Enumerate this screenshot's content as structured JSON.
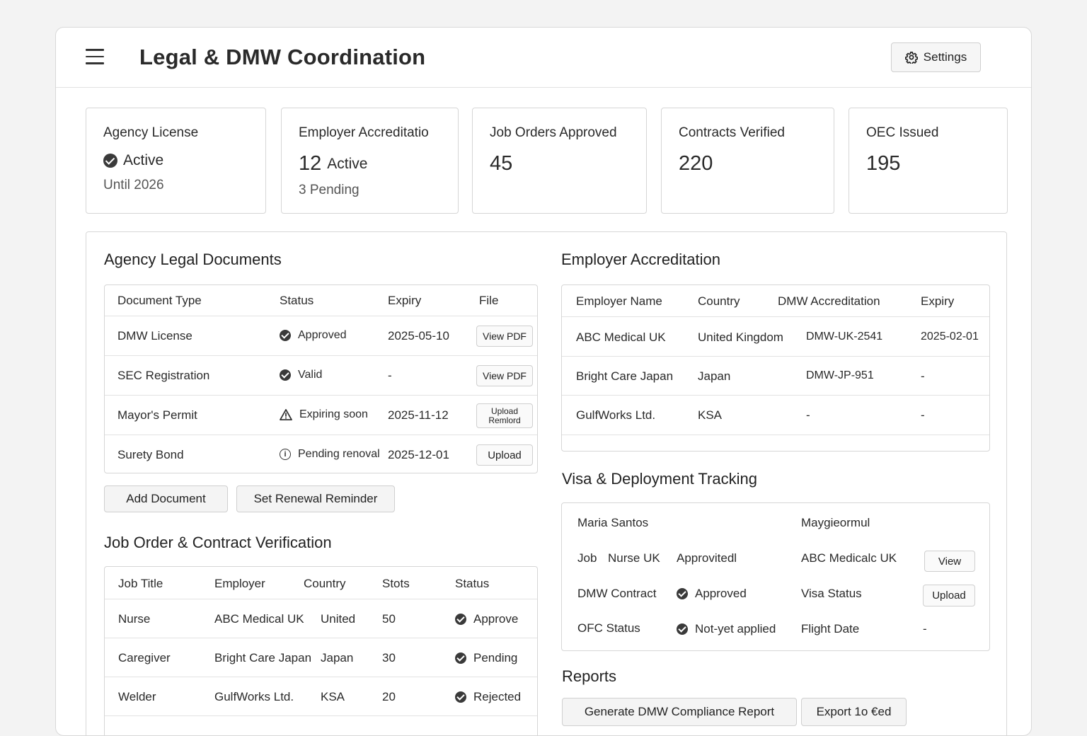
{
  "header": {
    "title": "Legal & DMW Coordination",
    "settings_label": "Settings"
  },
  "stats": [
    {
      "label": "Agency License",
      "status": "Active",
      "sub": "Until 2026"
    },
    {
      "label": "Employer Accreditatio",
      "value": "12",
      "suffix": "Active",
      "sub": "3 Pending"
    },
    {
      "label": "Job Orders Approved",
      "value": "45"
    },
    {
      "label": "Contracts Verified",
      "value": "220"
    },
    {
      "label": "OEC Issued",
      "value": "195"
    }
  ],
  "legal_docs": {
    "title": "Agency Legal Documents",
    "headers": [
      "Document Type",
      "Status",
      "Expiry",
      "File"
    ],
    "rows": [
      {
        "type": "DMW License",
        "status": "Approved",
        "status_icon": "check-icon",
        "expiry": "2025-05-10",
        "action": "View PDF"
      },
      {
        "type": "SEC Registration",
        "status": "Valid",
        "status_icon": "check-icon",
        "expiry": "-",
        "action": "View PDF"
      },
      {
        "type": "Mayor's Permit",
        "status": "Expiring soon",
        "status_icon": "warning-icon",
        "expiry": "2025-11-12",
        "action": "Upload Remlord"
      },
      {
        "type": "Surety Bond",
        "status": "Pending renoval",
        "status_icon": "info-icon",
        "expiry": "2025-12-01",
        "action": "Upload"
      }
    ],
    "add_label": "Add Document",
    "reminder_label": "Set Renewal Reminder"
  },
  "job_orders": {
    "title": "Job Order & Contract Verification",
    "headers": [
      "Job Title",
      "Employer",
      "Country",
      "Stots",
      "Status"
    ],
    "rows": [
      {
        "title": "Nurse",
        "employer": "ABC Medical UK",
        "country": "United",
        "slots": "50",
        "status": "Approve"
      },
      {
        "title": "Caregiver",
        "employer": "Bright Care Japan",
        "country": "Japan",
        "slots": "30",
        "status": "Pending"
      },
      {
        "title": "Welder",
        "employer": "GulfWorks Ltd.",
        "country": "KSA",
        "slots": "20",
        "status": "Rejected"
      }
    ]
  },
  "employer_accreditation": {
    "title": "Employer Accreditation",
    "headers": [
      "Employer Name",
      "Country",
      "DMW Accreditation",
      "Expiry"
    ],
    "rows": [
      {
        "name": "ABC Medical UK",
        "country": "United Kingdom",
        "accreditation": "DMW-UK-2541",
        "expiry": "2025-02-01"
      },
      {
        "name": "Bright Care Japan",
        "country": "Japan",
        "accreditation": "DMW-JP-951",
        "expiry": "-"
      },
      {
        "name": "GulfWorks Ltd.",
        "country": "KSA",
        "accreditation": "-",
        "expiry": "-"
      }
    ]
  },
  "visa_tracking": {
    "title": "Visa & Deployment Tracking",
    "worker_name": "Maria Santos",
    "worker_extra": "Maygieormul",
    "job_label": "Job",
    "job_value": "Nurse UK",
    "job_status": "Approvitedl",
    "employer_value": "ABC Medicalc UK",
    "view_label": "View",
    "contract_label": "DMW Contract",
    "contract_status": "Approved",
    "visa_label": "Visa Status",
    "upload_label": "Upload",
    "ofc_label": "OFC Status",
    "ofc_status": "Not-yet applied",
    "flight_label": "Flight Date",
    "flight_value": "-"
  },
  "reports": {
    "title": "Reports",
    "generate_label": "Generate DMW Compliance Report",
    "export_label": "Export 1o €ed"
  }
}
